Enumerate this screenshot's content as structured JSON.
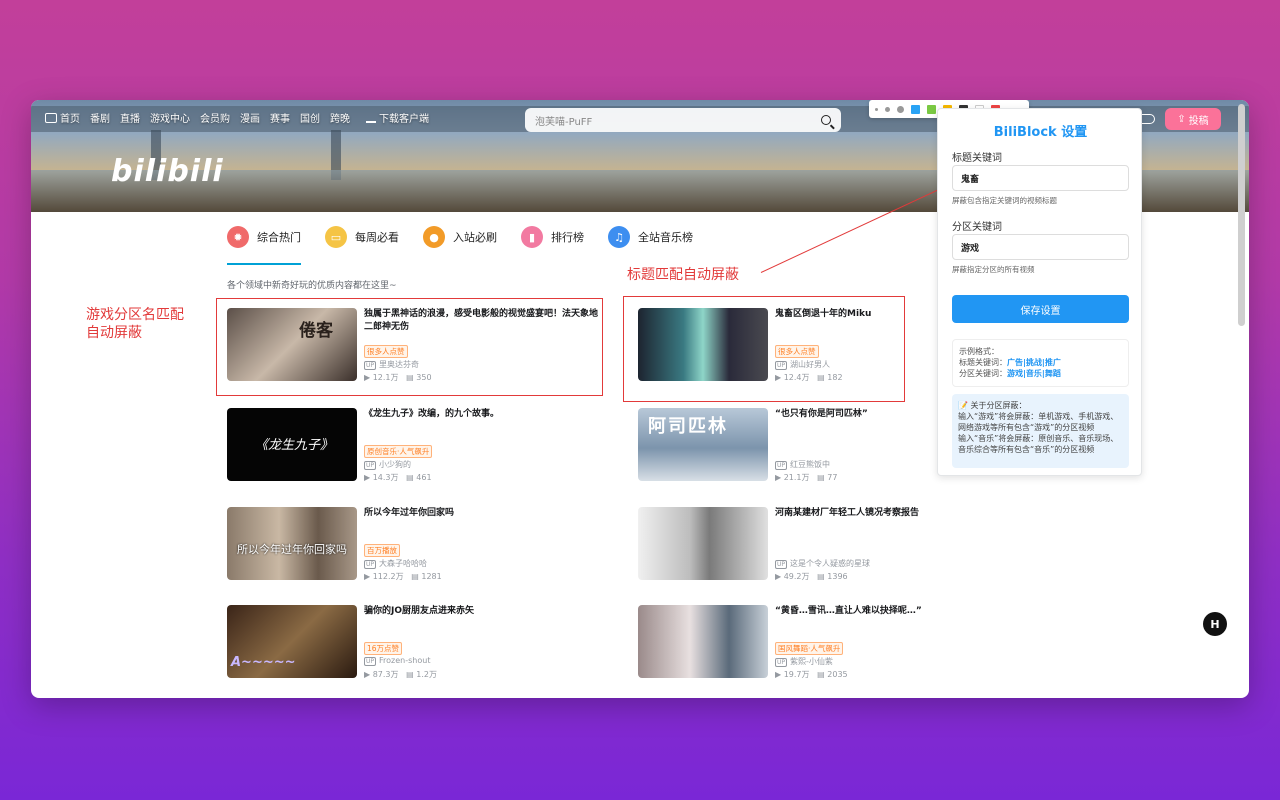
{
  "nav": {
    "home": "首页",
    "items": [
      "番剧",
      "直播",
      "游戏中心",
      "会员购",
      "漫画",
      "赛事",
      "国创",
      "跨晚"
    ],
    "download": "下载客户端",
    "search_placeholder": "泡芙喵-PuFF",
    "upload": "投稿",
    "logo": "bilibili"
  },
  "tabs": [
    {
      "label": "综合热门",
      "color": "#f06a6a",
      "icon": "flame-icon"
    },
    {
      "label": "每周必看",
      "color": "#f5c445",
      "icon": "calendar-icon"
    },
    {
      "label": "入站必刷",
      "color": "#f29b28",
      "icon": "medal-icon"
    },
    {
      "label": "排行榜",
      "color": "#f27aa1",
      "icon": "ranking-icon"
    },
    {
      "label": "全站音乐榜",
      "color": "#3d8ef0",
      "icon": "headphones-icon"
    }
  ],
  "subtitle": "各个领域中新奇好玩的优质内容都在这里~",
  "videos": [
    {
      "title": "独属于黑神话的浪漫，感受电影般的视觉盛宴吧！法天象地二郎神无伤",
      "tag": "很多人点赞",
      "uploader": "里奥达芬奇",
      "views": "12.1万",
      "comments": "350"
    },
    {
      "title": "鬼畜区倒退十年的Miku",
      "tag": "很多人点赞",
      "uploader": "湖山好男人",
      "views": "12.4万",
      "comments": "182"
    },
    {
      "title": "《龙生九子》改编，的九个故事。",
      "tag": "原创音乐·人气飙升",
      "uploader": "小少狗的",
      "views": "14.3万",
      "comments": "461"
    },
    {
      "title": "“也只有你是阿司匹林”",
      "tag": "",
      "uploader": "红豆熊饭中",
      "views": "21.1万",
      "comments": "77"
    },
    {
      "title": "所以今年过年你回家吗",
      "tag": "百万播放",
      "uploader": "大森子哈哈哈",
      "views": "112.2万",
      "comments": "1281"
    },
    {
      "title": "河南某建材厂年轻工人镜况考察报告",
      "tag": "",
      "uploader": "这是个令人疑惑的星球",
      "views": "49.2万",
      "comments": "1396"
    },
    {
      "title": "骗你的JO厨朋友点进来赤矢",
      "tag": "16万点赞",
      "uploader": "Frozen-shout",
      "views": "87.3万",
      "comments": "1.2万"
    },
    {
      "title": "“黄昏…雪讯…直让人难以抉择呢…”",
      "tag": "国风舞蹈·人气飙升",
      "uploader": "紫熙-小仙紫",
      "views": "19.7万",
      "comments": "2035"
    }
  ],
  "thumb_texts": {
    "t1": "倦客",
    "t3": "《龙生九子》",
    "t4": "阿司匹林",
    "t5": "所以今年过年你回家吗",
    "t7": "A~~~~~"
  },
  "annotations": {
    "left": "游戏分区名匹配\n自动屏蔽",
    "right": "标题匹配自动屏蔽"
  },
  "panel": {
    "title": "BiliBlock 设置",
    "title_kw_label": "标题关键词",
    "title_kw_value": "鬼畜",
    "title_kw_hint": "屏蔽包含指定关键词的视频标题",
    "section_kw_label": "分区关键词",
    "section_kw_value": "游戏",
    "section_kw_hint": "屏蔽指定分区的所有视频",
    "save": "保存设置",
    "example_head": "示例格式：",
    "example_title_prefix": "标题关键词：",
    "example_title_value": "广告|挑战|推广",
    "example_section_prefix": "分区关键词：",
    "example_section_value": "游戏|音乐|舞蹈",
    "about_head": "📝 关于分区屏蔽：",
    "about_body": "输入“游戏”将会屏蔽：单机游戏、手机游戏、网络游戏等所有包含“游戏”的分区视频\n输入“音乐”将会屏蔽：原创音乐、音乐现场、音乐综合等所有包含“音乐”的分区视频"
  },
  "colors": [
    "#29a3f5",
    "#7ac943",
    "#f5b800",
    "#333333",
    "#ffffff",
    "#ee4444"
  ],
  "fab": "H"
}
